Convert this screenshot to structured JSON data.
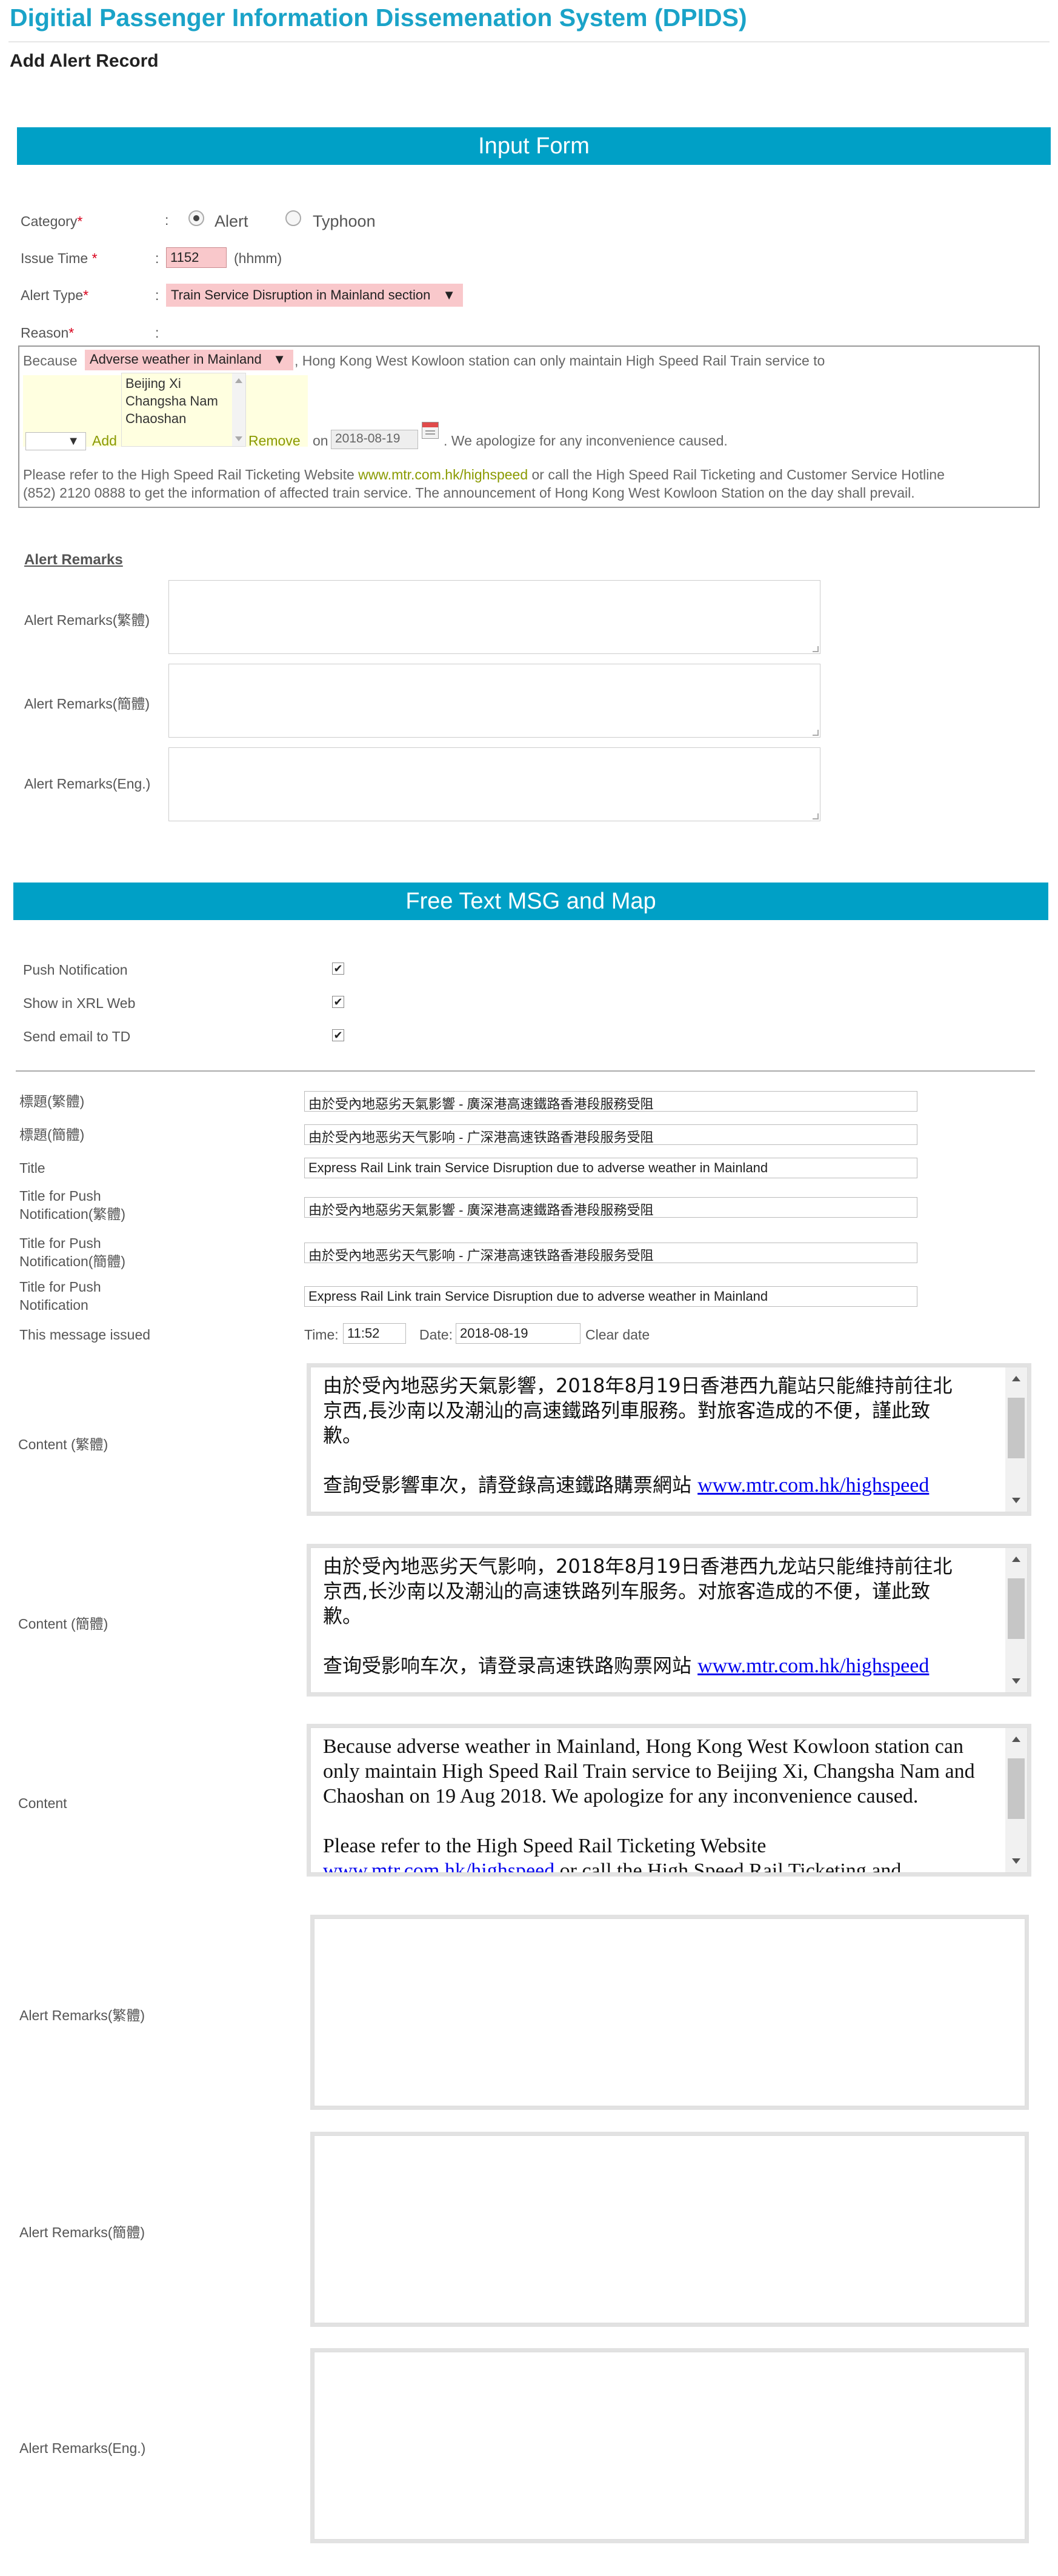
{
  "header": {
    "app_title": "Digitial Passenger Information Dissemenation System (DPIDS)",
    "page_title": "Add Alert Record"
  },
  "input_form": {
    "section_title": "Input Form",
    "category": {
      "label": "Category",
      "options": [
        {
          "label": "Alert",
          "selected": true
        },
        {
          "label": "Typhoon",
          "selected": false
        }
      ]
    },
    "issue_time": {
      "label": "Issue Time ",
      "value": "1152",
      "hint": "(hhmm)"
    },
    "alert_type": {
      "label": "Alert Type",
      "value": "Train Service Disruption in Mainland section"
    },
    "reason": {
      "label": "Reason",
      "because": "Because",
      "cause_value": "Adverse weather in Mainland",
      "sentence_part1": ", Hong Kong West Kowloon station can only maintain High Speed Rail Train service to",
      "stations": [
        "Beijing Xi",
        "Changsha Nam",
        "Chaoshan"
      ],
      "add_label": "Add",
      "remove_label": "Remove",
      "on_label": "on",
      "date_value": "2018-08-19",
      "sentence_part2": ". We apologize for any inconvenience caused.",
      "refer_part1": "Please refer to the High Speed Rail Ticketing Website ",
      "refer_link": "www.mtr.com.hk/highspeed",
      "refer_part2": " or call the High Speed Rail Ticketing and Customer Service Hotline",
      "refer_line2": "(852) 2120 0888 to get the information of affected train service. The announcement of Hong Kong West Kowloon Station on the day shall prevail."
    },
    "alert_remarks": {
      "heading": "Alert Remarks",
      "fields": [
        {
          "label": "Alert Remarks(繁體)",
          "value": ""
        },
        {
          "label": "Alert Remarks(簡體)",
          "value": ""
        },
        {
          "label": "Alert Remarks(Eng.)",
          "value": ""
        }
      ]
    }
  },
  "free_text": {
    "section_title": "Free Text MSG and Map",
    "checkboxes": [
      {
        "label": "Push Notification",
        "checked": true
      },
      {
        "label": "Show in XRL Web",
        "checked": true
      },
      {
        "label": "Send email to TD",
        "checked": true
      }
    ],
    "fields": [
      {
        "label": "標題(繁體)",
        "value": "由於受內地惡劣天氣影響 - 廣深港高速鐵路香港段服務受阻"
      },
      {
        "label": "標題(簡體)",
        "value": "由於受內地恶劣天气影响 - 广深港高速铁路香港段服务受阻"
      },
      {
        "label": "Title",
        "value": "Express Rail Link train Service Disruption due to adverse weather in Mainland"
      },
      {
        "label_line1": "Title for Push",
        "label_line2": "Notification(繁體)",
        "value": "由於受內地惡劣天氣影響 - 廣深港高速鐵路香港段服務受阻"
      },
      {
        "label_line1": "Title for Push",
        "label_line2": "Notification(簡體)",
        "value": "由於受內地恶劣天气影响 - 广深港高速铁路香港段服务受阻"
      },
      {
        "label_line1": "Title for Push",
        "label_line2": "Notification",
        "value": "Express Rail Link train Service Disruption due to adverse weather in Mainland"
      }
    ],
    "issued": {
      "label": "This message issued",
      "time_label": "Time:",
      "time_value": "11:52",
      "date_label": "Date:",
      "date_value": "2018-08-19",
      "clear_label": "Clear date"
    },
    "content_tc": {
      "label": "Content (繁體)",
      "line1": "由於受內地惡劣天氣影響，2018年8月19日香港西九龍站只能維持前往北",
      "line2": "京西,長沙南以及潮汕的高速鐵路列車服務。對旅客造成的不便，謹此致",
      "line3": "歉。",
      "line4_text": "查詢受影響車次，請登錄高速鐵路購票網站 ",
      "link": "www.mtr.com.hk/highspeed"
    },
    "content_sc": {
      "label": "Content (簡體)",
      "line1": "由於受內地恶劣天气影响，2018年8月19日香港西九龙站只能维持前往北",
      "line2": "京西,长沙南以及潮汕的高速铁路列车服务。对旅客造成的不便，谨此致",
      "line3": "歉。",
      "line4_text": "查询受影响车次，请登录高速铁路购票网站 ",
      "link": "www.mtr.com.hk/highspeed"
    },
    "content_en": {
      "label": "Content",
      "line1": "Because adverse weather in Mainland, Hong Kong West Kowloon station can",
      "line2": "only maintain High Speed Rail Train service to Beijing Xi, Changsha Nam and",
      "line3": "Chaoshan on 19 Aug 2018. We apologize for any inconvenience caused.",
      "line4": "Please refer to the High Speed Rail Ticketing Website",
      "link": "www.mtr.com.hk/highspeed",
      "line5_rest": " or call the High Speed Rail Ticketing and"
    },
    "remarks": [
      {
        "label": "Alert Remarks(繁體)",
        "value": ""
      },
      {
        "label": "Alert Remarks(簡體)",
        "value": ""
      },
      {
        "label": "Alert Remarks(Eng.)",
        "value": ""
      }
    ]
  },
  "colors": {
    "accent": "#00a0c6",
    "title": "#1aa3c8",
    "required_field": "#f9c8cb",
    "link_green": "#8a9a00"
  },
  "icons": [
    "calendar-icon",
    "chevron-down-icon",
    "scroll-up-icon",
    "scroll-down-icon"
  ]
}
